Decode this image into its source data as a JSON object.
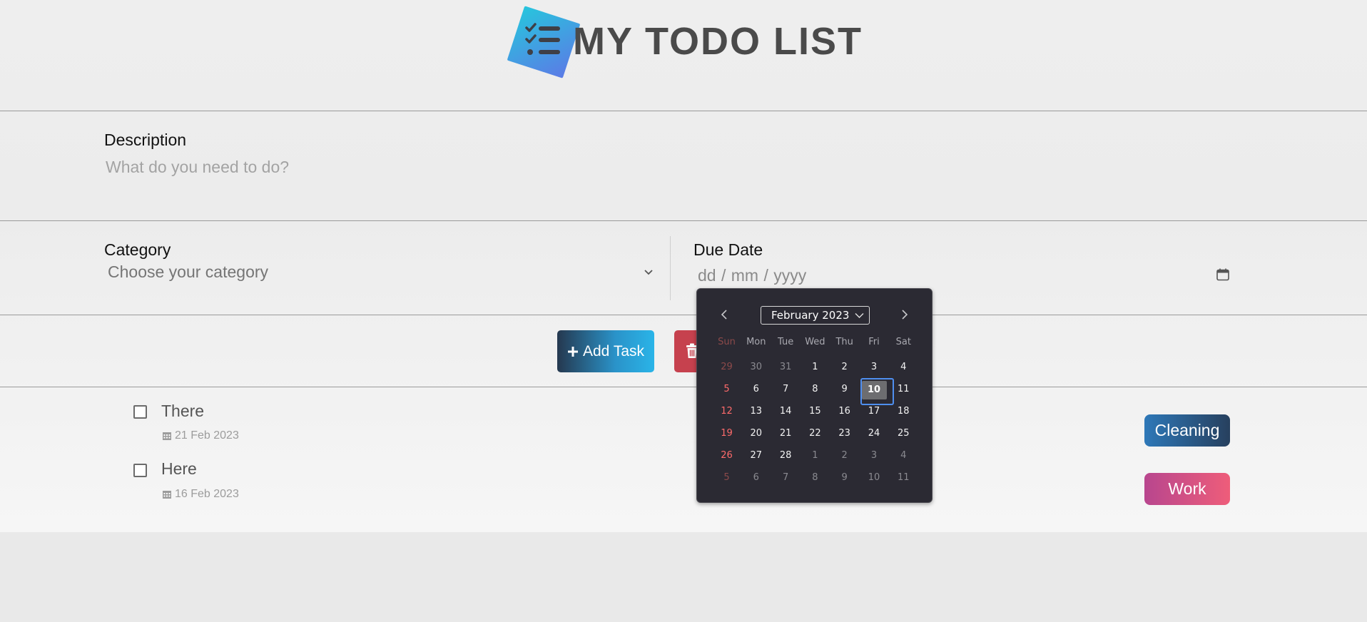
{
  "header": {
    "title": "MY TODO LIST",
    "logo_icon": "checklist-icon"
  },
  "description": {
    "label": "Description",
    "placeholder": "What do you need to do?"
  },
  "category": {
    "label": "Category",
    "value": "Choose your category"
  },
  "due_date": {
    "label": "Due Date",
    "placeholder": "dd / mm / yyyy"
  },
  "actions": {
    "add_label": "Add Task"
  },
  "todos": [
    {
      "title": "There",
      "date": "21 Feb 2023",
      "tag": "Cleaning"
    },
    {
      "title": "Here",
      "date": "16 Feb 2023",
      "tag": "Work"
    }
  ],
  "datepicker": {
    "month_label": "February 2023",
    "weekdays": [
      "Sun",
      "Mon",
      "Tue",
      "Wed",
      "Thu",
      "Fri",
      "Sat"
    ],
    "selected": "10",
    "weeks": [
      [
        "29",
        "30",
        "31",
        "1",
        "2",
        "3",
        "4"
      ],
      [
        "5",
        "6",
        "7",
        "8",
        "9",
        "10",
        "11"
      ],
      [
        "12",
        "13",
        "14",
        "15",
        "16",
        "17",
        "18"
      ],
      [
        "19",
        "20",
        "21",
        "22",
        "23",
        "24",
        "25"
      ],
      [
        "26",
        "27",
        "28",
        "1",
        "2",
        "3",
        "4"
      ],
      [
        "5",
        "6",
        "7",
        "8",
        "9",
        "10",
        "11"
      ]
    ]
  },
  "colors": {
    "tag_cleaning": "#2e78b8",
    "tag_work": "#e5587c",
    "delete_button": "#c6414e",
    "picker_bg": "#2b2a33"
  }
}
